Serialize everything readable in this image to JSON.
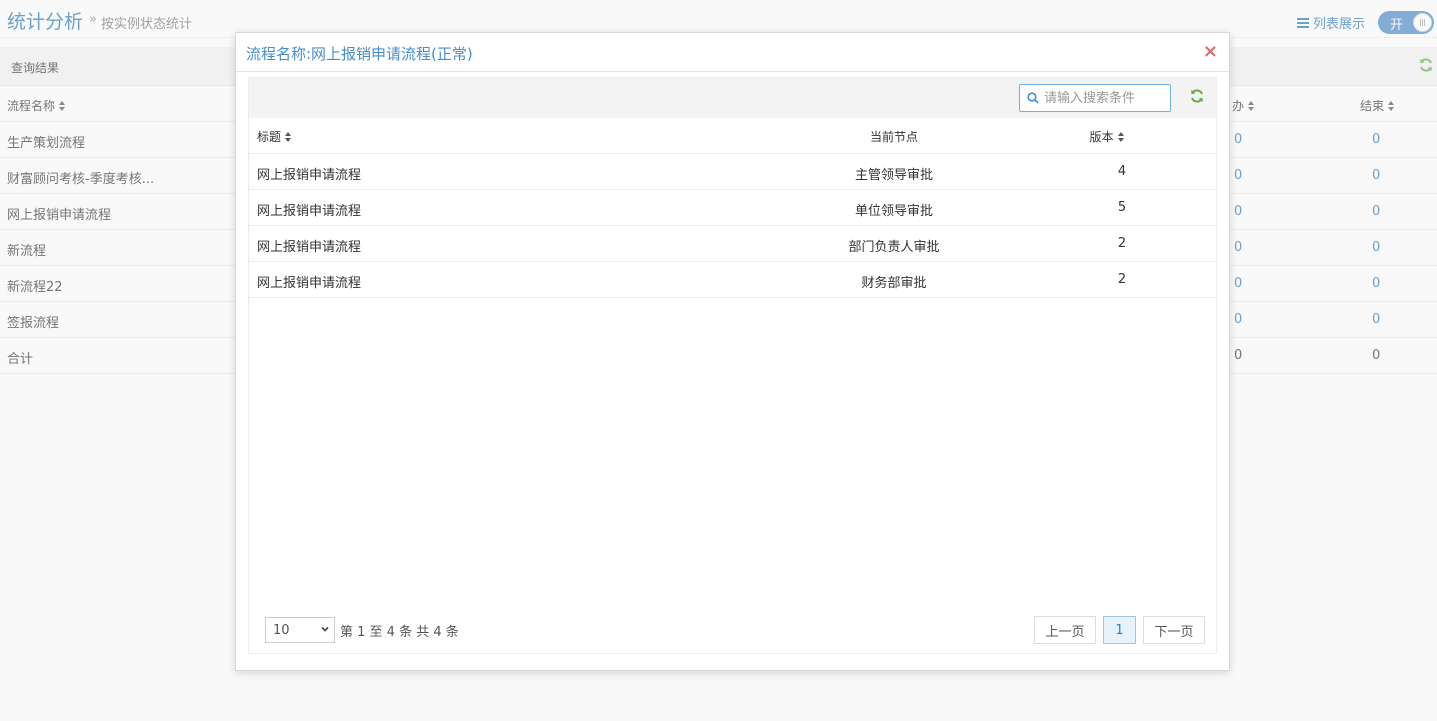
{
  "header": {
    "title": "统计分析",
    "crumb_sep": "»",
    "crumb": "按实例状态统计",
    "list_view_label": "列表展示",
    "toggle_label": "开"
  },
  "background": {
    "panel_label": "查询结果",
    "columns": [
      "流程名称",
      "办",
      "结束"
    ],
    "rows": [
      {
        "name": "生产策划流程",
        "a": "0",
        "b": "0"
      },
      {
        "name": "财富顾问考核-季度考核...",
        "a": "0",
        "b": "0"
      },
      {
        "name": "网上报销申请流程",
        "a": "0",
        "b": "0"
      },
      {
        "name": "新流程",
        "a": "0",
        "b": "0"
      },
      {
        "name": "新流程22",
        "a": "0",
        "b": "0"
      },
      {
        "name": "签报流程",
        "a": "0",
        "b": "0"
      },
      {
        "name": "合计",
        "a": "0",
        "b": "0"
      }
    ]
  },
  "modal": {
    "title": "流程名称:网上报销申请流程(正常)",
    "close": "×",
    "search_placeholder": "请输入搜索条件",
    "columns": {
      "title": "标题",
      "node": "当前节点",
      "version": "版本"
    },
    "rows": [
      {
        "title": "网上报销申请流程",
        "node": "主管领导审批",
        "version": "4"
      },
      {
        "title": "网上报销申请流程",
        "node": "单位领导审批",
        "version": "5"
      },
      {
        "title": "网上报销申请流程",
        "node": "部门负责人审批",
        "version": "2"
      },
      {
        "title": "网上报销申请流程",
        "node": "财务部审批",
        "version": "2"
      }
    ],
    "pager": {
      "page_size": "10",
      "info": "第 1 至 4 条 共 4 条",
      "prev": "上一页",
      "current": "1",
      "next": "下一页"
    }
  },
  "colors": {
    "accent": "#2679b5",
    "modal_title": "#478fca",
    "refresh": "#69aa46",
    "close": "#d16e6c"
  },
  "icons": [
    "list-icon",
    "refresh-icon",
    "search-icon",
    "sort-icon",
    "close-icon",
    "chevron-down-icon"
  ]
}
